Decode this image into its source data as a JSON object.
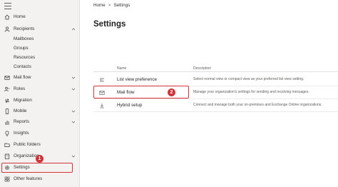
{
  "sidebar": {
    "items": [
      {
        "key": "home",
        "label": "Home",
        "icon": "home-icon"
      },
      {
        "key": "recipients",
        "label": "Recipients",
        "icon": "person-icon",
        "expanded": true
      },
      {
        "key": "mailboxes",
        "label": "Mailboxes"
      },
      {
        "key": "groups",
        "label": "Groups"
      },
      {
        "key": "resources",
        "label": "Resources"
      },
      {
        "key": "contacts",
        "label": "Contacts"
      },
      {
        "key": "mail-flow",
        "label": "Mail flow",
        "icon": "mail-icon"
      },
      {
        "key": "roles",
        "label": "Roles",
        "icon": "roles-icon"
      },
      {
        "key": "migration",
        "label": "Migration",
        "icon": "migration-icon"
      },
      {
        "key": "mobile",
        "label": "Mobile",
        "icon": "mobile-icon"
      },
      {
        "key": "reports",
        "label": "Reports",
        "icon": "reports-icon"
      },
      {
        "key": "insights",
        "label": "Insights",
        "icon": "insights-icon"
      },
      {
        "key": "public-folders",
        "label": "Public folders",
        "icon": "folder-icon"
      },
      {
        "key": "organization",
        "label": "Organization",
        "icon": "organization-icon"
      },
      {
        "key": "settings",
        "label": "Settings",
        "icon": "gear-icon",
        "selected": true
      },
      {
        "key": "other-features",
        "label": "Other features",
        "icon": "grid-icon"
      }
    ]
  },
  "breadcrumb": {
    "home": "Home",
    "current": "Settings"
  },
  "page": {
    "title": "Settings"
  },
  "table": {
    "headers": {
      "name": "Name",
      "description": "Description"
    },
    "rows": [
      {
        "name": "List view preference",
        "description": "Select normal view or compact view as your preferred list view setting.",
        "icon": "list-view-icon"
      },
      {
        "name": "Mail flow",
        "description": "Manage your organization's settings for sending and receiving messages.",
        "icon": "mail-icon"
      },
      {
        "name": "Hybrid setup",
        "description": "Connect and manage both your on-premises and Exchange Online organizations.",
        "icon": "download-icon"
      }
    ]
  },
  "annotations": {
    "badge_1": "1",
    "badge_2": "2"
  },
  "colors": {
    "highlight": "#d13438",
    "sidebar_bg": "#f3f2f1",
    "text": "#323130"
  }
}
